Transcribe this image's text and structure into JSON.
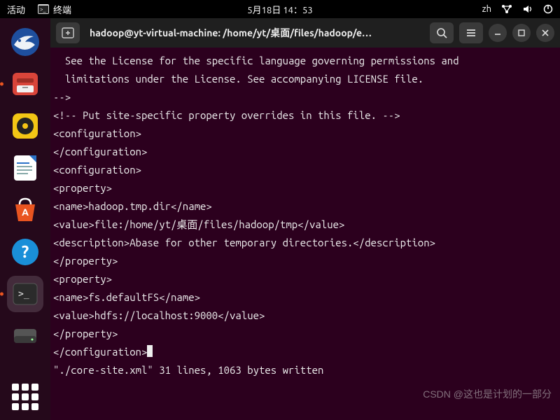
{
  "topbar": {
    "activities": "活动",
    "app_label": "终端",
    "datetime": "5月18日 14：53",
    "input_method": "zh"
  },
  "dock": {
    "items": [
      {
        "name": "thunderbird-icon"
      },
      {
        "name": "files-icon"
      },
      {
        "name": "rhythmbox-icon"
      },
      {
        "name": "libreoffice-writer-icon"
      },
      {
        "name": "software-center-icon"
      },
      {
        "name": "help-icon"
      },
      {
        "name": "terminal-icon"
      },
      {
        "name": "drive-icon"
      }
    ]
  },
  "window": {
    "title": "hadoop@yt-virtual-machine: /home/yt/桌面/files/hadoop/e…"
  },
  "terminal": {
    "lines": [
      "  See the License for the specific language governing permissions and",
      "  limitations under the License. See accompanying LICENSE file.",
      "-->",
      "",
      "<!-- Put site-specific property overrides in this file. -->",
      "",
      "<configuration>",
      "</configuration>",
      "<configuration>",
      "<property>",
      "<name>hadoop.tmp.dir</name>",
      "<value>file:/home/yt/桌面/files/hadoop/tmp</value>",
      "<description>Abase for other temporary directories.</description>",
      "</property>",
      "<property>",
      "<name>fs.defaultFS</name>",
      "<value>hdfs://localhost:9000</value>",
      "</property>",
      "</configuration>"
    ],
    "status": "\"./core-site.xml\" 31 lines, 1063 bytes written"
  },
  "watermark": "CSDN @这也是计划的一部分"
}
